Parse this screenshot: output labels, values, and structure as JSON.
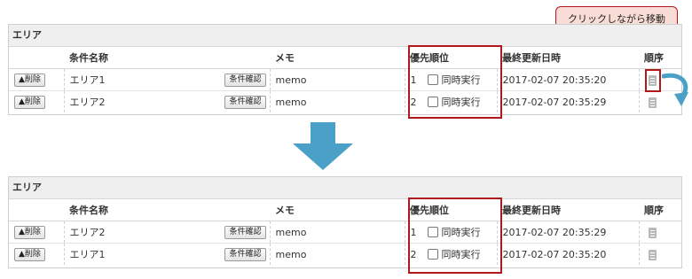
{
  "callout": {
    "text": "クリックしながら移動"
  },
  "before": {
    "title": "エリア",
    "headers": {
      "name": "条件名称",
      "memo": "メモ",
      "priority": "優先順位",
      "updated": "最終更新日時",
      "order": "順序"
    },
    "rows": [
      {
        "delete_label": "▲削除",
        "name": "エリア1",
        "confirm_label": "条件確認",
        "memo": "memo",
        "priority": "1",
        "concurrent_label": "同時実行",
        "updated": "2017-02-07 20:35:20"
      },
      {
        "delete_label": "▲削除",
        "name": "エリア2",
        "confirm_label": "条件確認",
        "memo": "memo",
        "priority": "2",
        "concurrent_label": "同時実行",
        "updated": "2017-02-07 20:35:29"
      }
    ]
  },
  "after": {
    "title": "エリア",
    "headers": {
      "name": "条件名称",
      "memo": "メモ",
      "priority": "優先順位",
      "updated": "最終更新日時",
      "order": "順序"
    },
    "rows": [
      {
        "delete_label": "▲削除",
        "name": "エリア2",
        "confirm_label": "条件確認",
        "memo": "memo",
        "priority": "1",
        "concurrent_label": "同時実行",
        "updated": "2017-02-07 20:35:29"
      },
      {
        "delete_label": "▲削除",
        "name": "エリア1",
        "confirm_label": "条件確認",
        "memo": "memo",
        "priority": "2",
        "concurrent_label": "同時実行",
        "updated": "2017-02-07 20:35:20"
      }
    ]
  },
  "colors": {
    "highlight": "#b0181e",
    "arrow": "#4aa0c6",
    "callout_bg": "#f8dcd5"
  },
  "icons": {
    "order_handle": "document-icon",
    "flow": "down-arrow-icon",
    "drag": "curved-arrow-icon"
  }
}
